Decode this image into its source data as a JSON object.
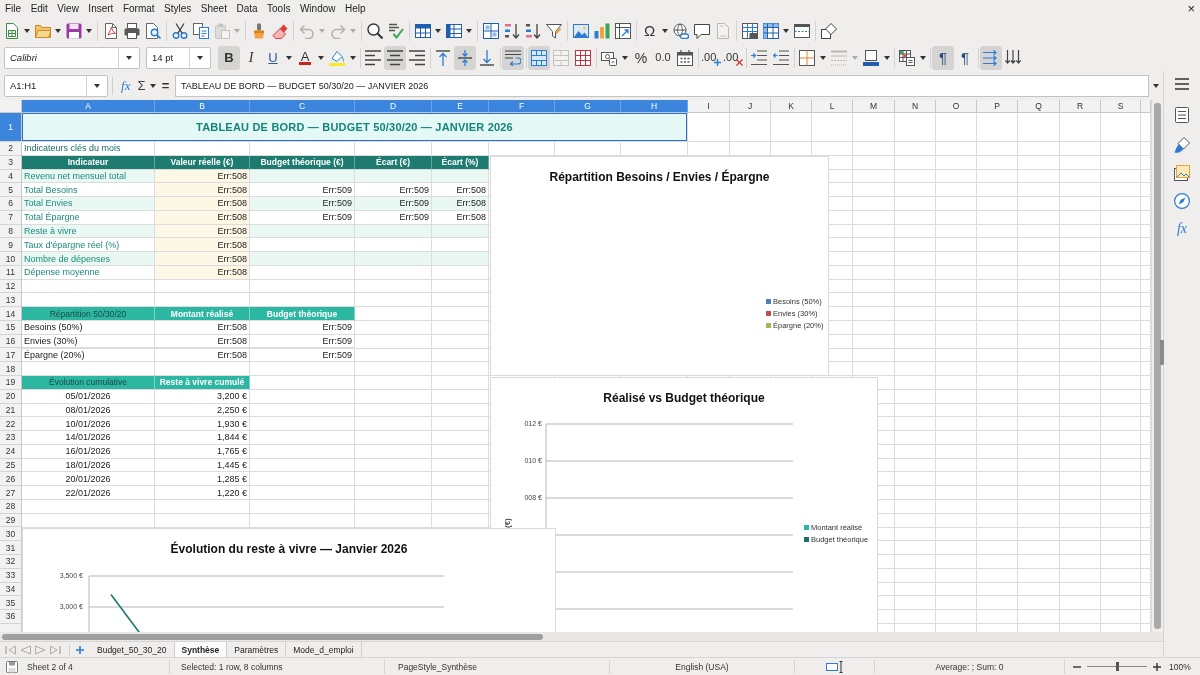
{
  "menu_bar": {
    "items": [
      "File",
      "Edit",
      "View",
      "Insert",
      "Format",
      "Styles",
      "Sheet",
      "Data",
      "Tools",
      "Window",
      "Help"
    ],
    "close": "×"
  },
  "standard_toolbar": {
    "paste": {
      "disabled": true
    },
    "undo": {
      "disabled": true
    },
    "redo": {
      "disabled": true
    },
    "special_character": {
      "label": "Ω"
    },
    "headers_and_footers": {
      "disabled": true
    }
  },
  "formatting_toolbar": {
    "font_name": "Calibri",
    "font_size": "14 pt",
    "bold": {
      "label": "B",
      "on": true
    },
    "italic": {
      "label": "I",
      "on": false
    },
    "underline": {
      "label": "U",
      "on": false
    },
    "font_color": {
      "label": "A"
    },
    "align_left": {
      "on": false
    },
    "align_center": {
      "on": true
    },
    "align_right": {
      "on": false
    },
    "align_top": {
      "on": false
    },
    "align_middle": {
      "on": true
    },
    "align_bottom": {
      "on": false
    },
    "wrap_text": {
      "on": true
    },
    "merge_and_center": {
      "on": true
    },
    "merge_cells": {
      "disabled": true
    },
    "percent": {
      "label": "%"
    },
    "number": {
      "label": "0.0"
    },
    "add_decimal": {
      "label": ".00"
    },
    "delete_decimal": {
      "label": ".00"
    },
    "border_style": {
      "disabled": true
    },
    "left_to_right": {
      "label": "¶",
      "on": true
    },
    "right_to_left": {
      "label": "¶",
      "on": false
    },
    "text_left_to_right": {
      "on": true
    },
    "text_top_to_bottom": {
      "on": false
    }
  },
  "formula_bar": {
    "name_box": "A1:H1",
    "function_wizard": "fx",
    "sum": "Σ",
    "equals": "=",
    "content": "TABLEAU DE BORD — BUDGET 50/30/20 — JANVIER 2026"
  },
  "sidebar": {
    "functions": "fx"
  },
  "sheet": {
    "columns": [
      {
        "label": "A",
        "selected": true
      },
      {
        "label": "B",
        "selected": true
      },
      {
        "label": "C",
        "selected": true
      },
      {
        "label": "D",
        "selected": true
      },
      {
        "label": "E",
        "selected": true
      },
      {
        "label": "F",
        "selected": true
      },
      {
        "label": "G",
        "selected": true
      },
      {
        "label": "H",
        "selected": true
      },
      {
        "label": "I",
        "selected": false
      },
      {
        "label": "J",
        "selected": false
      },
      {
        "label": "K",
        "selected": false
      },
      {
        "label": "L",
        "selected": false
      },
      {
        "label": "M",
        "selected": false
      },
      {
        "label": "N",
        "selected": false
      },
      {
        "label": "O",
        "selected": false
      },
      {
        "label": "P",
        "selected": false
      },
      {
        "label": "Q",
        "selected": false
      },
      {
        "label": "R",
        "selected": false
      },
      {
        "label": "S",
        "selected": false
      }
    ],
    "rows": [
      {
        "label": "1",
        "selected": true,
        "kind": "title",
        "cells": [
          {
            "kind": "title",
            "text": "TABLEAU DE BORD — BUDGET 50/30/20 — JANVIER 2026"
          }
        ]
      },
      {
        "label": "2",
        "selected": false,
        "kind": "section",
        "cells": [
          {
            "kind": "label",
            "text": "Indicateurs clés du mois"
          }
        ]
      },
      {
        "label": "3",
        "selected": false,
        "kind": "table_header",
        "cells": [
          {
            "kind": "heading",
            "text": "Indicateur"
          },
          {
            "kind": "heading",
            "text": "Valeur réelle (€)"
          },
          {
            "kind": "heading",
            "text": "Budget théorique (€)"
          },
          {
            "kind": "heading",
            "text": "Écart (€)"
          },
          {
            "kind": "heading",
            "text": "Écart (%)"
          }
        ]
      },
      {
        "label": "4",
        "selected": false,
        "kind": "indicator",
        "cells": [
          {
            "kind": "label",
            "text": "Revenu net mensuel total"
          },
          {
            "kind": "number",
            "text": "Err:508"
          }
        ]
      },
      {
        "label": "5",
        "selected": false,
        "kind": "indicator",
        "cells": [
          {
            "kind": "label",
            "text": "Total Besoins"
          },
          {
            "kind": "number",
            "text": "Err:508"
          },
          {
            "kind": "number",
            "text": "Err:509"
          },
          {
            "kind": "number",
            "text": "Err:509"
          },
          {
            "kind": "number",
            "text": "Err:508"
          }
        ]
      },
      {
        "label": "6",
        "selected": false,
        "kind": "indicator",
        "cells": [
          {
            "kind": "label",
            "text": "Total Envies"
          },
          {
            "kind": "number",
            "text": "Err:508"
          },
          {
            "kind": "number",
            "text": "Err:509"
          },
          {
            "kind": "number",
            "text": "Err:509"
          },
          {
            "kind": "number",
            "text": "Err:508"
          }
        ]
      },
      {
        "label": "7",
        "selected": false,
        "kind": "indicator",
        "cells": [
          {
            "kind": "label",
            "text": "Total Épargne"
          },
          {
            "kind": "number",
            "text": "Err:508"
          },
          {
            "kind": "number",
            "text": "Err:509"
          },
          {
            "kind": "number",
            "text": "Err:509"
          },
          {
            "kind": "number",
            "text": "Err:508"
          }
        ]
      },
      {
        "label": "8",
        "selected": false,
        "kind": "indicator",
        "cells": [
          {
            "kind": "label",
            "text": "Reste à vivre"
          },
          {
            "kind": "number",
            "text": "Err:508"
          }
        ]
      },
      {
        "label": "9",
        "selected": false,
        "kind": "indicator",
        "cells": [
          {
            "kind": "label",
            "text": "Taux d'épargne réel (%)"
          },
          {
            "kind": "number",
            "text": "Err:508"
          }
        ]
      },
      {
        "label": "10",
        "selected": false,
        "kind": "indicator",
        "cells": [
          {
            "kind": "label",
            "text": "Nombre de dépenses"
          },
          {
            "kind": "number",
            "text": "Err:508"
          }
        ]
      },
      {
        "label": "11",
        "selected": false,
        "kind": "indicator",
        "cells": [
          {
            "kind": "label",
            "text": "Dépense moyenne"
          },
          {
            "kind": "number",
            "text": "Err:508"
          }
        ]
      },
      {
        "label": "12",
        "selected": false,
        "kind": "blank"
      },
      {
        "label": "13",
        "selected": false,
        "kind": "blank"
      },
      {
        "label": "14",
        "selected": false,
        "kind": "subheader",
        "cells": [
          {
            "kind": "caption",
            "text": "Répartition 50/30/20"
          },
          {
            "kind": "heading",
            "text": "Montant réalisé"
          },
          {
            "kind": "heading",
            "text": "Budget théorique"
          }
        ]
      },
      {
        "label": "15",
        "selected": false,
        "kind": "data",
        "cells": [
          {
            "kind": "label",
            "text": "Besoins (50%)"
          },
          {
            "kind": "number",
            "text": "Err:508"
          },
          {
            "kind": "number",
            "text": "Err:509"
          }
        ]
      },
      {
        "label": "16",
        "selected": false,
        "kind": "data",
        "cells": [
          {
            "kind": "label",
            "text": "Envies (30%)"
          },
          {
            "kind": "number",
            "text": "Err:508"
          },
          {
            "kind": "number",
            "text": "Err:509"
          }
        ]
      },
      {
        "label": "17",
        "selected": false,
        "kind": "data",
        "cells": [
          {
            "kind": "label",
            "text": "Épargne (20%)"
          },
          {
            "kind": "number",
            "text": "Err:508"
          },
          {
            "kind": "number",
            "text": "Err:509"
          }
        ]
      },
      {
        "label": "18",
        "selected": false,
        "kind": "blank"
      },
      {
        "label": "19",
        "selected": false,
        "kind": "subheader",
        "cells": [
          {
            "kind": "caption",
            "text": "Évolution cumulative"
          },
          {
            "kind": "heading",
            "text": "Reste à vivre cumulé"
          }
        ]
      },
      {
        "label": "20",
        "selected": false,
        "kind": "data",
        "cells": [
          {
            "kind": "date",
            "text": "05/01/2026"
          },
          {
            "kind": "number",
            "text": "3,200 €"
          }
        ]
      },
      {
        "label": "21",
        "selected": false,
        "kind": "data",
        "cells": [
          {
            "kind": "date",
            "text": "08/01/2026"
          },
          {
            "kind": "number",
            "text": "2,250 €"
          }
        ]
      },
      {
        "label": "22",
        "selected": false,
        "kind": "data",
        "cells": [
          {
            "kind": "date",
            "text": "10/01/2026"
          },
          {
            "kind": "number",
            "text": "1,930 €"
          }
        ]
      },
      {
        "label": "23",
        "selected": false,
        "kind": "data",
        "cells": [
          {
            "kind": "date",
            "text": "14/01/2026"
          },
          {
            "kind": "number",
            "text": "1,844 €"
          }
        ]
      },
      {
        "label": "24",
        "selected": false,
        "kind": "data",
        "cells": [
          {
            "kind": "date",
            "text": "16/01/2026"
          },
          {
            "kind": "number",
            "text": "1,765 €"
          }
        ]
      },
      {
        "label": "25",
        "selected": false,
        "kind": "data",
        "cells": [
          {
            "kind": "date",
            "text": "18/01/2026"
          },
          {
            "kind": "number",
            "text": "1,445 €"
          }
        ]
      },
      {
        "label": "26",
        "selected": false,
        "kind": "data",
        "cells": [
          {
            "kind": "date",
            "text": "20/01/2026"
          },
          {
            "kind": "number",
            "text": "1,285 €"
          }
        ]
      },
      {
        "label": "27",
        "selected": false,
        "kind": "data",
        "cells": [
          {
            "kind": "date",
            "text": "22/01/2026"
          },
          {
            "kind": "number",
            "text": "1,220 €"
          }
        ]
      },
      {
        "label": "28",
        "selected": false,
        "kind": "blank"
      },
      {
        "label": "29",
        "selected": false,
        "kind": "blank"
      },
      {
        "label": "30",
        "selected": false,
        "kind": "blank"
      },
      {
        "label": "31",
        "selected": false,
        "kind": "blank"
      },
      {
        "label": "32",
        "selected": false,
        "kind": "blank"
      },
      {
        "label": "33",
        "selected": false,
        "kind": "blank"
      },
      {
        "label": "34",
        "selected": false,
        "kind": "blank"
      },
      {
        "label": "35",
        "selected": false,
        "kind": "blank"
      },
      {
        "label": "36",
        "selected": false,
        "kind": "blank"
      }
    ],
    "charts": [
      {
        "kind": "pie",
        "title": "Répartition Besoins / Envies / Épargne",
        "legend": [
          {
            "label": "Besoins (50%)",
            "color": "#4f81bd"
          },
          {
            "label": "Envies (30%)",
            "color": "#c0504d"
          },
          {
            "label": "Épargne (20%)",
            "color": "#9bbb59"
          }
        ]
      },
      {
        "kind": "bar",
        "title": "Réalisé vs Budget théorique",
        "axis_title": "(€)",
        "tick_labels": [
          "012 €",
          "010 €",
          "008 €"
        ],
        "legend": [
          {
            "label": "Montant réalisé",
            "color": "#2ab5a0"
          },
          {
            "label": "Budget théorique",
            "color": "#1e6e66"
          }
        ]
      },
      {
        "kind": "line",
        "title": "Évolution du reste à vivre — Janvier 2026",
        "tick_labels": [
          "3,500 €",
          "3,000 €"
        ]
      }
    ]
  },
  "sheet_tabs": [
    {
      "label": "Budget_50_30_20",
      "selected": false
    },
    {
      "label": "Synthèse",
      "selected": true
    },
    {
      "label": "Paramètres",
      "selected": false
    },
    {
      "label": "Mode_d_emploi",
      "selected": false
    }
  ],
  "status_bar": {
    "sheet_position": "Sheet 2 of 4",
    "selection": "Selected: 1 row, 8 columns",
    "page_style": "PageStyle_Synthèse",
    "language": "English (USA)",
    "statistics": "Average: ; Sum: 0",
    "zoom": {
      "level": 0.5,
      "percent": "100%"
    }
  }
}
